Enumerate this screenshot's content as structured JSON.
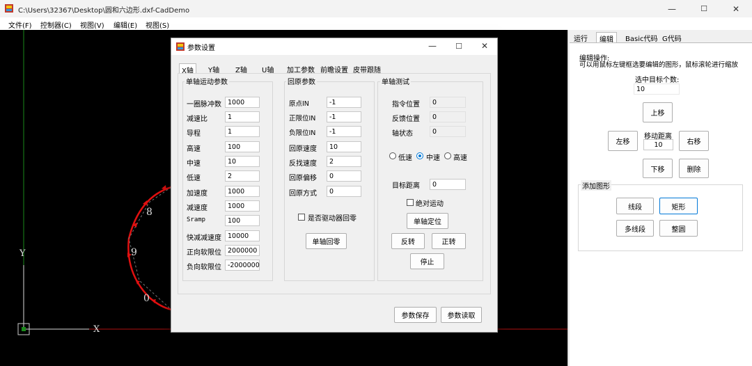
{
  "window": {
    "title": "C:\\Users\\32367\\Desktop\\圆和六边形.dxf-CadDemo",
    "min": "—",
    "max": "☐",
    "close": "✕"
  },
  "menubar": [
    "文件(F)",
    "控制器(C)",
    "视图(V)",
    "编辑(E)",
    "视图(S)"
  ],
  "canvas": {
    "y_label": "Y",
    "x_label": "X",
    "points": [
      "8",
      "9",
      "0"
    ]
  },
  "right_panel": {
    "tabs": [
      "运行",
      "编辑",
      "Basic代码",
      "G代码"
    ],
    "edit_instructions_title": "编辑操作:",
    "edit_instructions": "可以用鼠标左键框选要编辑的图形，鼠标滚轮进行缩放",
    "selected_count_label": "选中目标个数:",
    "selected_count": "10",
    "move_up": "上移",
    "move_left": "左移",
    "move_distance_label": "移动距离",
    "move_distance": "10",
    "move_right": "右移",
    "move_down": "下移",
    "delete": "删除",
    "add_shape_title": "添加图形",
    "line": "线段",
    "rect": "矩形",
    "polyline": "多线段",
    "circle": "整圆"
  },
  "dialog": {
    "title": "参数设置",
    "min": "—",
    "max": "☐",
    "close": "✕",
    "tabs": [
      "X轴",
      "Y轴",
      "Z轴",
      "U轴",
      "加工参数",
      "前瞻设置",
      "皮带跟随"
    ],
    "single_axis": {
      "title": "单轴运动参数",
      "params": [
        {
          "label": "一圈脉冲数",
          "value": "1000"
        },
        {
          "label": "减速比",
          "value": "1"
        },
        {
          "label": "导程",
          "value": "1"
        },
        {
          "label": "高速",
          "value": "100"
        },
        {
          "label": "中速",
          "value": "10"
        },
        {
          "label": "低速",
          "value": "2"
        },
        {
          "label": "加速度",
          "value": "1000"
        },
        {
          "label": "减速度",
          "value": "1000"
        },
        {
          "label": "Sramp",
          "value": "100"
        },
        {
          "label": "快减减速度",
          "value": "10000"
        },
        {
          "label": "正向软限位",
          "value": "2000000"
        },
        {
          "label": "负向软限位",
          "value": "-2000000"
        }
      ]
    },
    "homing": {
      "title": "回原参数",
      "params": [
        {
          "label": "原点IN",
          "value": "-1"
        },
        {
          "label": "正限位IN",
          "value": "-1"
        },
        {
          "label": "负限位IN",
          "value": "-1"
        },
        {
          "label": "回原速度",
          "value": "10"
        },
        {
          "label": "反找速度",
          "value": "2"
        },
        {
          "label": "回原偏移",
          "value": "0"
        },
        {
          "label": "回原方式",
          "value": "0"
        }
      ],
      "driver_home_label": "是否驱动器回零",
      "single_home_button": "单轴回零"
    },
    "test": {
      "title": "单轴测试",
      "status": [
        {
          "label": "指令位置",
          "value": "0"
        },
        {
          "label": "反馈位置",
          "value": "0"
        },
        {
          "label": "轴状态",
          "value": "0"
        }
      ],
      "speeds": [
        "低速",
        "中速",
        "高速"
      ],
      "target_label": "目标距离",
      "target_value": "0",
      "absolute_label": "绝对运动",
      "locate_button": "单轴定位",
      "reverse_button": "反转",
      "forward_button": "正转",
      "stop_button": "停止"
    },
    "save_button": "参数保存",
    "load_button": "参数读取"
  }
}
